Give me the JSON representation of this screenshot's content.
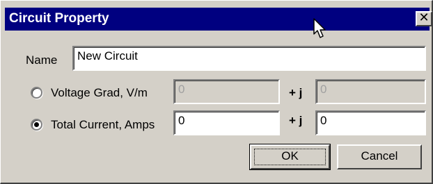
{
  "window": {
    "title": "Circuit Property",
    "close_glyph": "✕"
  },
  "form": {
    "name_label": "Name",
    "name_value": "New Circuit",
    "voltage_label": "Voltage Grad,  V/m",
    "voltage_real": "0",
    "voltage_imag": "0",
    "voltage_selected": false,
    "current_label": "Total Current, Amps",
    "current_real": "0",
    "current_imag": "0",
    "current_selected": true,
    "imag_label": "+ j"
  },
  "buttons": {
    "ok_label": "OK",
    "cancel_label": "Cancel"
  },
  "colors": {
    "titlebar": "#000080",
    "face": "#d4d0c8"
  }
}
